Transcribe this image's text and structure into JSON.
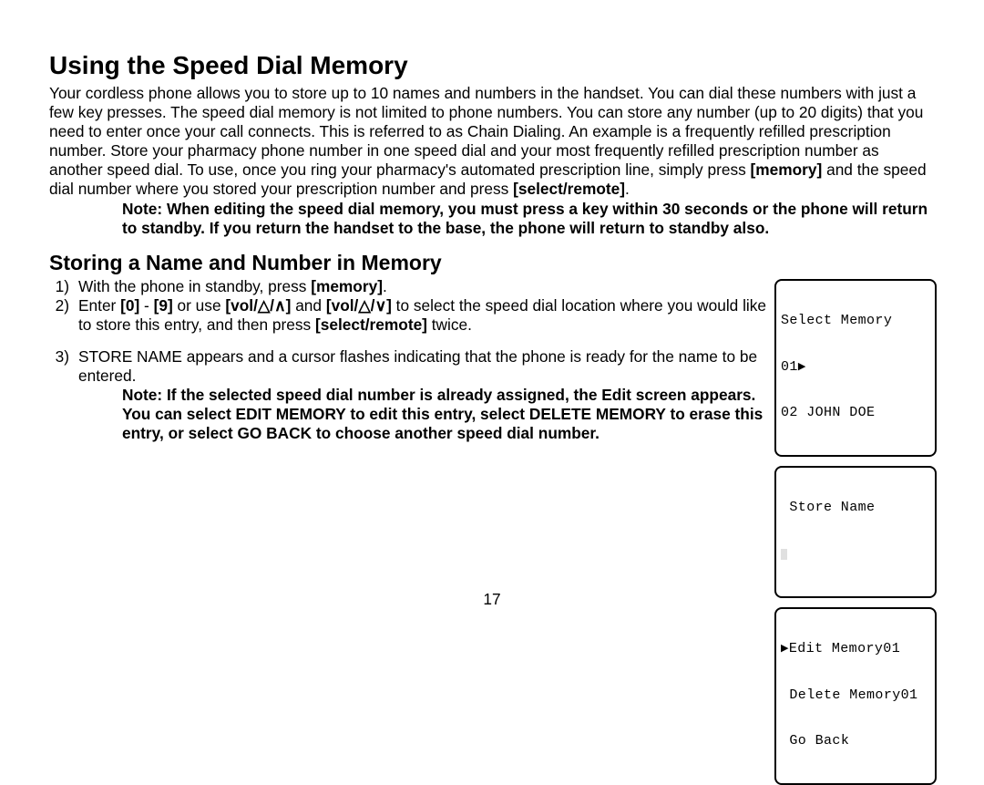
{
  "page": {
    "title": "Using the Speed Dial Memory",
    "intro_pre": "Your cordless phone allows you to store up to 10 names and numbers in the handset. You can dial these numbers with just a few key presses. The speed dial memory is not limited to phone numbers. You can store any number (up to 20 digits) that you need to enter once your call connects. This is referred to as Chain Dialing. An example is a frequently refilled prescription number. Store your pharmacy phone number in one speed dial and your most frequently refilled prescription number as another speed dial. To use, once you ring your pharmacy's automated prescription line, simply press ",
    "intro_b1": "[memory]",
    "intro_mid": " and the speed dial number where you stored your prescription number and press ",
    "intro_b2": "[select/remote]",
    "intro_post": ".",
    "note1": "Note: When editing the speed dial memory, you must press a key within 30 seconds or the phone will return to standby. If you return the handset to the base, the phone will return to standby also.",
    "subhead": "Storing a Name and Number in Memory",
    "step1_num": "1)",
    "step1_a": "With the phone in standby, press ",
    "step1_b": "[memory]",
    "step1_c": ".",
    "step2_num": "2)",
    "step2_a": "Enter ",
    "step2_b1": "[0]",
    "step2_mid1": " - ",
    "step2_b2": "[9]",
    "step2_mid2": " or use ",
    "step2_b3": "[vol/△/∧]",
    "step2_mid3": " and ",
    "step2_b4": "[vol/△/∨]",
    "step2_mid4": " to select the speed dial location where you would like to store this entry, and then press ",
    "step2_b5": "[select/remote]",
    "step2_mid5": " twice.",
    "step3_num": "3)",
    "step3": "STORE NAME appears and a cursor flashes indicating that the phone is ready for the name to be entered.",
    "note2": "Note: If the selected speed dial number is already assigned, the Edit screen appears. You can select EDIT MEMORY to edit this entry, select DELETE MEMORY to erase this entry, or select GO BACK to choose another speed dial number.",
    "page_number": "17"
  },
  "screens": {
    "s1": {
      "l1": "Select Memory",
      "l2a": "01",
      "l2b": "",
      "l3": "02 JOHN DOE"
    },
    "s2": {
      "l1": " Store Name"
    },
    "s3": {
      "l1": "Edit Memory01",
      "l2": "Delete Memory01",
      "l3": "Go Back"
    }
  }
}
